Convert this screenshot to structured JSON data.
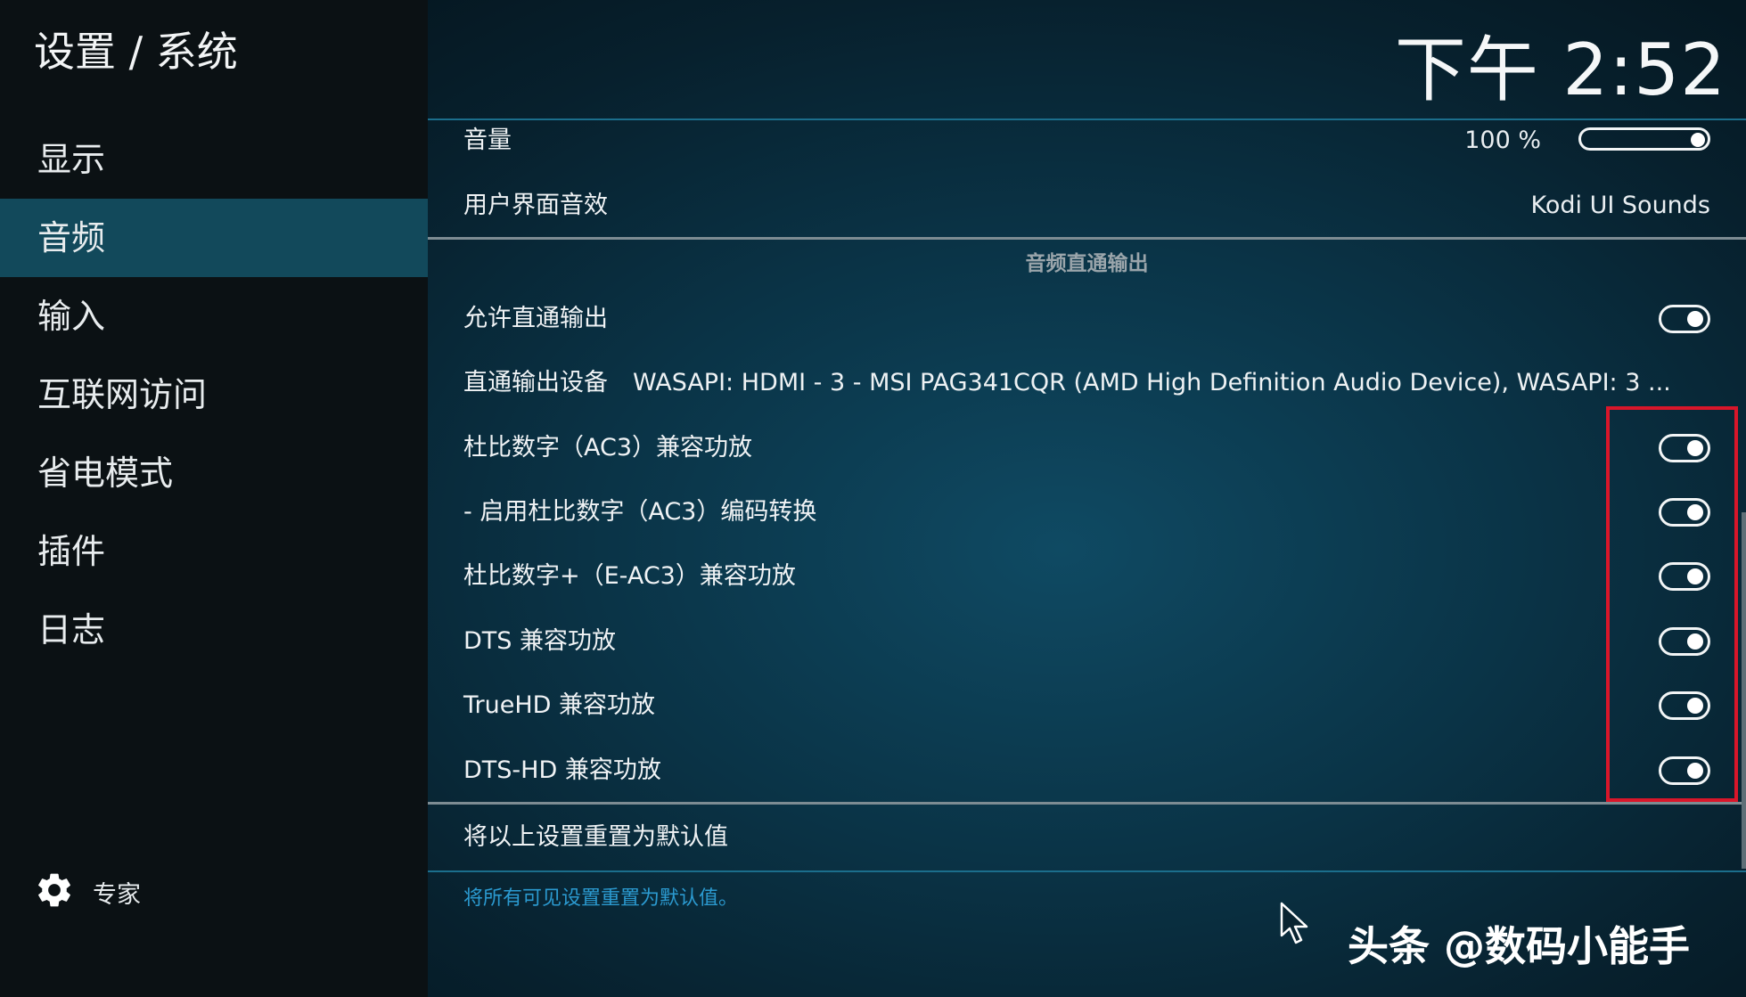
{
  "breadcrumb": "设置 / 系统",
  "clock": "下午 2:52",
  "sidebar": {
    "items": [
      {
        "label": "显示",
        "active": false
      },
      {
        "label": "音频",
        "active": true
      },
      {
        "label": "输入",
        "active": false
      },
      {
        "label": "互联网访问",
        "active": false
      },
      {
        "label": "省电模式",
        "active": false
      },
      {
        "label": "插件",
        "active": false
      },
      {
        "label": "日志",
        "active": false
      }
    ],
    "expert": {
      "icon": "gear-icon",
      "label": "专家"
    }
  },
  "settings": {
    "volume": {
      "label": "音量",
      "value": "100 %",
      "level": 1.0
    },
    "ui_sounds": {
      "label": "用户界面音效",
      "value": "Kodi UI Sounds"
    },
    "section_header": "音频直通输出",
    "allow_passthrough": {
      "label": "允许直通输出",
      "enabled": true
    },
    "passthrough_device": {
      "label": "直通输出设备",
      "value": "WASAPI: HDMI - 3 - MSI PAG341CQR (AMD High Definition Audio Device), WASAPI: 3 ..."
    },
    "toggles": [
      {
        "label": "杜比数字（AC3）兼容功放",
        "enabled": true
      },
      {
        "label": "- 启用杜比数字（AC3）编码转换",
        "enabled": true
      },
      {
        "label": "杜比数字+（E-AC3）兼容功放",
        "enabled": true
      },
      {
        "label": "DTS 兼容功放",
        "enabled": true
      },
      {
        "label": "TrueHD 兼容功放",
        "enabled": true
      },
      {
        "label": "DTS-HD 兼容功放",
        "enabled": true
      }
    ],
    "reset": {
      "label": "将以上设置重置为默认值"
    },
    "description": "将所有可见设置重置为默认值。"
  },
  "watermark": "头条 @数码小能手",
  "colors": {
    "active_nav": "#12495b",
    "highlight_box": "#d9162a",
    "description_text": "#2b9ad0"
  }
}
